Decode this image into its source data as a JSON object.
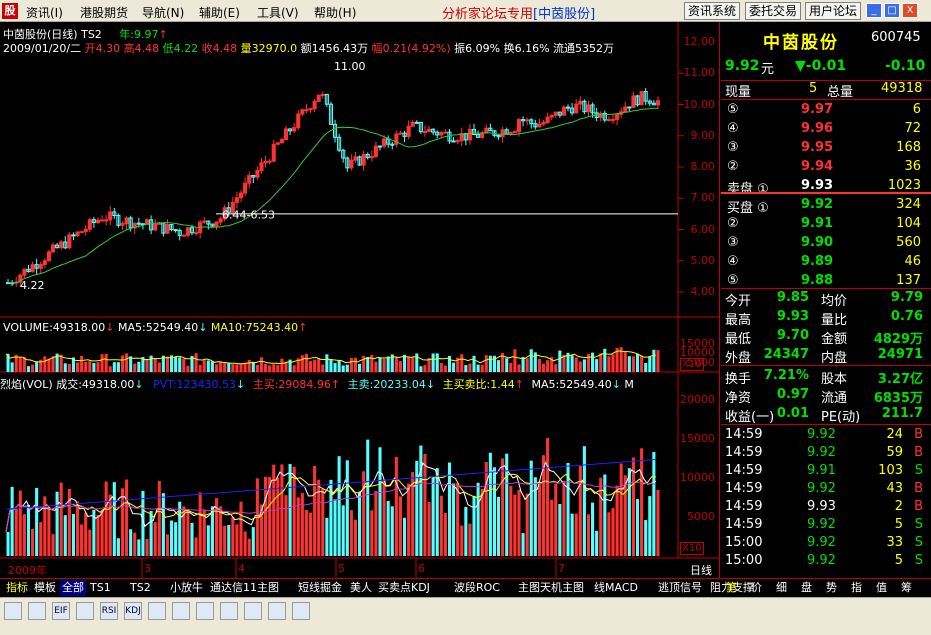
{
  "menubar": {
    "app_icon": "app-logo-icon",
    "items": [
      "资讯(I)",
      "港股期货",
      "导航(N)",
      "辅助(E)",
      "工具(V)",
      "帮助(H)"
    ],
    "forum_label": "分析家论坛专用",
    "forum_stock": "[中茵股份]",
    "buttons": [
      "资讯系统",
      "委托交易",
      "用户论坛"
    ],
    "window_buttons": [
      "_",
      "□",
      "X"
    ]
  },
  "chart": {
    "title": "中茵股份(日线)",
    "indicator": "TS2",
    "year_label": "年:9.97",
    "ohlc_line": {
      "date": "2009/01/20/二",
      "open": "开4.30",
      "high": "高4.48",
      "low": "低4.22",
      "close": "收4.48",
      "volume": "量32970.0",
      "amount": "额1456.43万",
      "change": "幅0.21(4.92%)",
      "amplitude": "振6.09%",
      "turnover": "换6.16%",
      "float": "流通5352万"
    },
    "annotations": {
      "high": "11.00",
      "low": "4.22",
      "range": "6.44-6.53"
    },
    "price_ticks": [
      "12.00",
      "11.00",
      "10.00",
      "9.00",
      "8.00",
      "7.00",
      "6.00",
      "5.00",
      "4.00"
    ],
    "volume_header": {
      "volume": "VOLUME:49318.00",
      "ma5": "MA5:52549.40",
      "ma10": "MA10:75243.40"
    },
    "volume_ticks": [
      "15000",
      "10000",
      "5000"
    ],
    "volume_unit": "X10",
    "ind_header": {
      "name": "烈焰(VOL)",
      "vol": "成交:49318.00",
      "pvt": "PVT:123430.53",
      "buy": "主买:29084.96",
      "sell": "主卖:20233.04",
      "ratio": "主买卖比:1.44",
      "ma5": "MA5:52549.40",
      "more": "M"
    },
    "ind_ticks": [
      "20000",
      "15000",
      "10000",
      "5000"
    ],
    "ind_unit": "X10",
    "month_labels": [
      "2009年",
      "3",
      "4",
      "5",
      "6",
      "7"
    ],
    "period_label": "日线"
  },
  "colors": {
    "up": "#ff3232",
    "up_hollow": "#ff3232",
    "down": "#54ffff",
    "ma": "#33cc33",
    "axis": "#c00000",
    "yellow": "#ffff00",
    "blue": "#2020ff",
    "purple": "#cc33cc"
  },
  "quote": {
    "name": "中茵股份",
    "code": "600745",
    "price": "9.92",
    "unit": "元",
    "change": "▼-0.01",
    "change_pct": "-0.10",
    "xianliang_label": "现量",
    "xianliang": "5",
    "zongliang_label": "总量",
    "zongliang": "49318",
    "sell_levels": [
      {
        "label": "⑤",
        "price": "9.97",
        "vol": "6"
      },
      {
        "label": "④",
        "price": "9.96",
        "vol": "72"
      },
      {
        "label": "③",
        "price": "9.95",
        "vol": "168"
      },
      {
        "label": "②",
        "price": "9.94",
        "vol": "36"
      },
      {
        "label": "卖盘 ①",
        "price": "9.93",
        "vol": "1023"
      }
    ],
    "buy_levels": [
      {
        "label": "买盘 ①",
        "price": "9.92",
        "vol": "324"
      },
      {
        "label": "②",
        "price": "9.91",
        "vol": "104"
      },
      {
        "label": "③",
        "price": "9.90",
        "vol": "560"
      },
      {
        "label": "④",
        "price": "9.89",
        "vol": "46"
      },
      {
        "label": "⑤",
        "price": "9.88",
        "vol": "137"
      }
    ],
    "stats": [
      {
        "l1": "今开",
        "v1": "9.85",
        "l2": "均价",
        "v2": "9.79"
      },
      {
        "l1": "最高",
        "v1": "9.93",
        "l2": "量比",
        "v2": "0.76"
      },
      {
        "l1": "最低",
        "v1": "9.70",
        "l2": "金额",
        "v2": "4829万"
      },
      {
        "l1": "外盘",
        "v1": "24347",
        "l2": "内盘",
        "v2": "24971"
      }
    ],
    "stats2": [
      {
        "l1": "换手",
        "v1": "7.21%",
        "l2": "股本",
        "v2": "3.27亿"
      },
      {
        "l1": "净资",
        "v1": "0.97",
        "l2": "流通",
        "v2": "6835万"
      },
      {
        "l1": "收益(一)",
        "v1": "0.01",
        "l2": "PE(动)",
        "v2": "211.7"
      }
    ],
    "ticks": [
      {
        "time": "14:59",
        "price": "9.92",
        "vol": "24",
        "bs": "B"
      },
      {
        "time": "14:59",
        "price": "9.92",
        "vol": "59",
        "bs": "B"
      },
      {
        "time": "14:59",
        "price": "9.91",
        "vol": "103",
        "bs": "S"
      },
      {
        "time": "14:59",
        "price": "9.92",
        "vol": "43",
        "bs": "B"
      },
      {
        "time": "14:59",
        "price": "9.93",
        "vol": "2",
        "bs": "B"
      },
      {
        "time": "14:59",
        "price": "9.92",
        "vol": "5",
        "bs": "S"
      },
      {
        "time": "15:00",
        "price": "9.92",
        "vol": "33",
        "bs": "S"
      },
      {
        "time": "15:00",
        "price": "9.92",
        "vol": "5",
        "bs": "S"
      }
    ]
  },
  "tabs": [
    "指标",
    "模板",
    "全部",
    "TS1",
    "TS2",
    "小放牛",
    "通达信11主图",
    "短线掘金",
    "美人",
    "买卖点KDJ",
    "波段ROC",
    "主图天机主图",
    "线MACD",
    "逃顶信号",
    "阻力支撑"
  ],
  "right_tabs": [
    "笔",
    "价",
    "细",
    "盘",
    "势",
    "指",
    "值",
    "筹"
  ],
  "toolbar_icons": [
    "chart-icon",
    "zoom-icon",
    "eif-icon",
    "wave-icon",
    "rsi-icon",
    "kdj-icon",
    "tools-icon",
    "link-icon",
    "arrow-up-icon",
    "pen-icon",
    "crosshair-icon",
    "up-arrow-icon",
    "down-arrow-icon"
  ],
  "toolbar_labels": [
    "",
    "",
    "EIF",
    "",
    "RSI",
    "KDJ",
    "",
    "",
    "",
    "",
    "",
    "",
    ""
  ]
}
